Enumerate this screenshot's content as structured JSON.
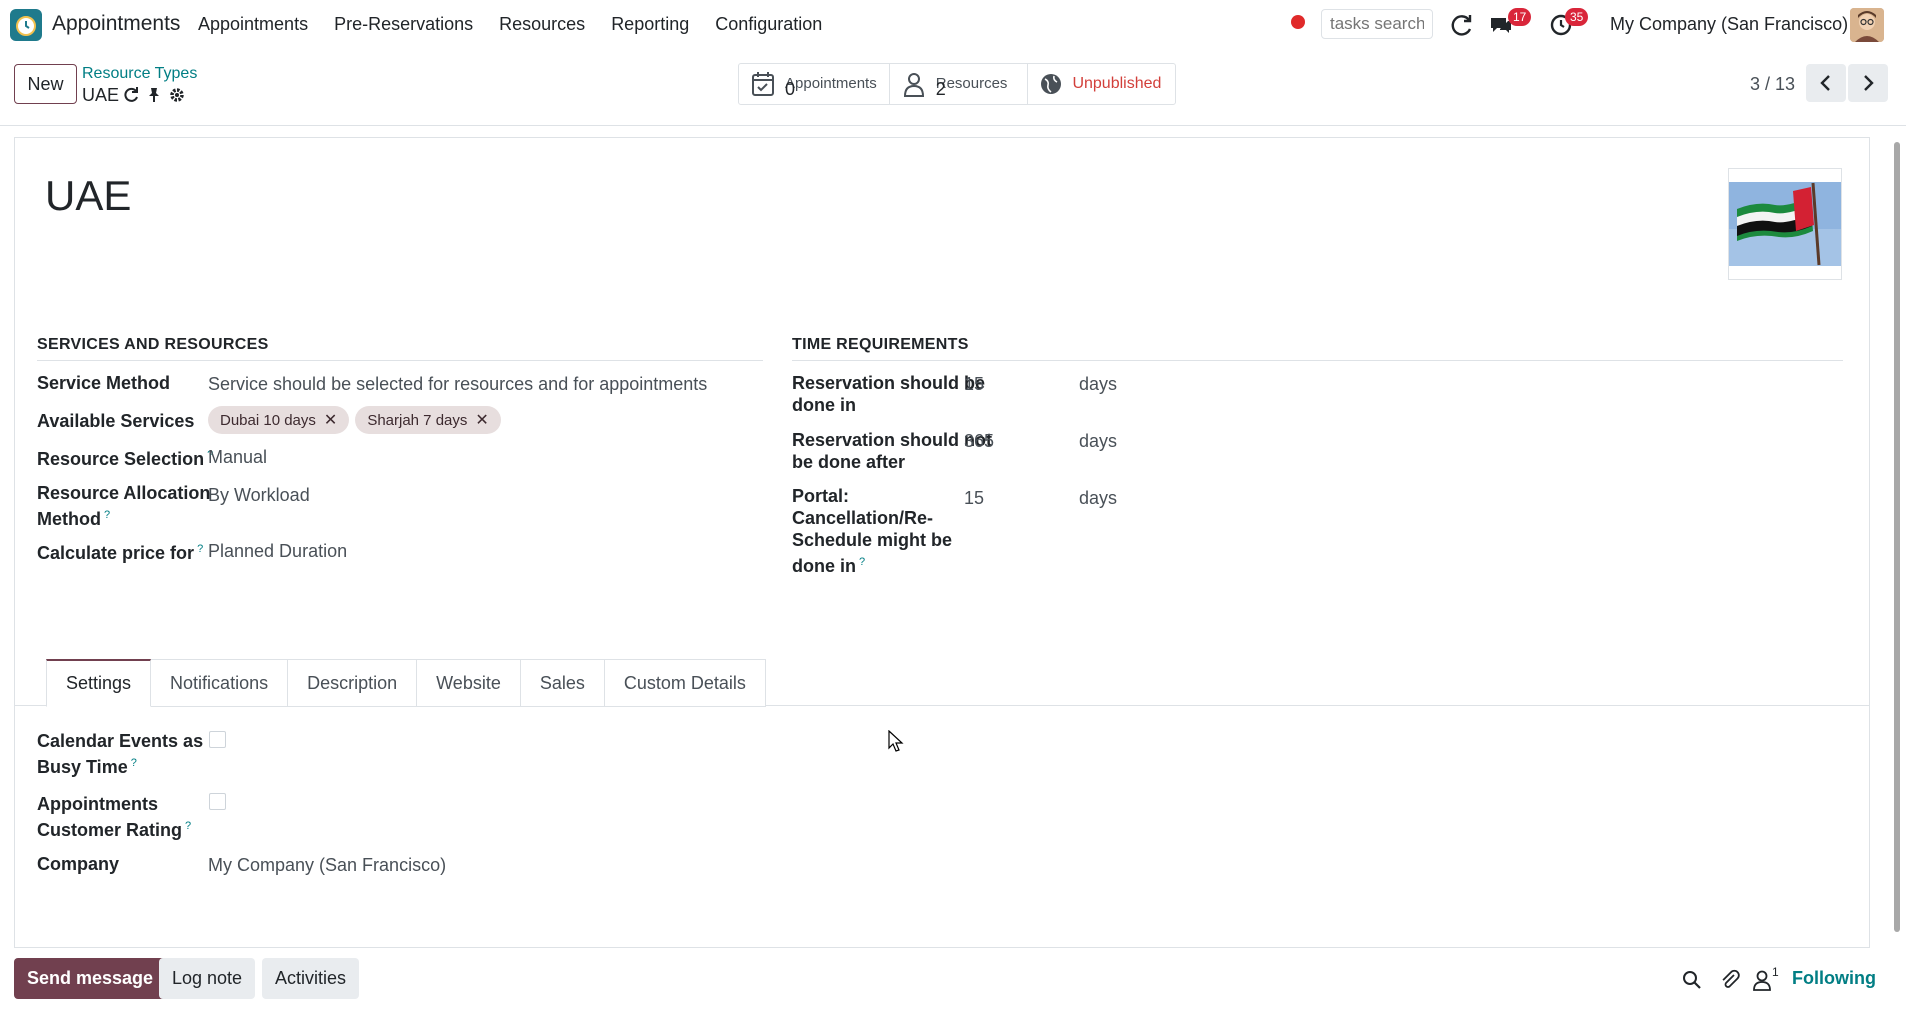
{
  "app": {
    "name": "Appointments"
  },
  "menu": [
    "Appointments",
    "Pre-Reservations",
    "Resources",
    "Reporting",
    "Configuration"
  ],
  "navbar": {
    "tasks_search_placeholder": "tasks search",
    "messages_count": "17",
    "activities_count": "35",
    "company": "My Company (San Francisco)"
  },
  "control_panel": {
    "new_label": "New",
    "breadcrumb_parent": "Resource Types",
    "breadcrumb_current": "UAE",
    "pager": "3 / 13"
  },
  "smart_buttons": {
    "appointments_label": "Appointments",
    "appointments_value": "0",
    "resources_label": "Resources",
    "resources_value": "2",
    "publish_label": "Unpublished"
  },
  "record": {
    "title": "UAE",
    "image_icon": "uae-flag-image"
  },
  "services_group": {
    "title": "SERVICES AND RESOURCES",
    "service_method_label": "Service Method",
    "service_method_value": "Service should be selected for resources and for appointments",
    "available_services_label": "Available Services",
    "available_services": [
      "Dubai 10 days",
      "Sharjah 7 days"
    ],
    "resource_selection_label": "Resource Selection",
    "resource_selection_value": "Manual",
    "allocation_label_line1": "Resource Allocation",
    "allocation_label_line2": "Method",
    "allocation_value": "By Workload",
    "price_label": "Calculate price for",
    "price_value": "Planned Duration",
    "help_mark": "?"
  },
  "time_group": {
    "title": "TIME REQUIREMENTS",
    "done_in_label_1": "Reservation should be",
    "done_in_label_2": "done in",
    "done_in_value": "15",
    "not_after_label_1": "Reservation should not",
    "not_after_label_2": "be done after",
    "not_after_value": "365",
    "portal_label_1": "Portal:",
    "portal_label_2": "Cancellation/Re-",
    "portal_label_3": "Schedule might be",
    "portal_label_4": "done in",
    "portal_value": "15",
    "unit": "days"
  },
  "tabs": [
    "Settings",
    "Notifications",
    "Description",
    "Website",
    "Sales",
    "Custom Details"
  ],
  "settings_tab": {
    "busy_label_1": "Calendar Events as",
    "busy_label_2": "Busy Time",
    "rating_label_1": "Appointments",
    "rating_label_2": "Customer Rating",
    "company_label": "Company",
    "company_value": "My Company (San Francisco)"
  },
  "chatter": {
    "send_message": "Send message",
    "log_note": "Log note",
    "activities": "Activities",
    "followers_count": "1",
    "following": "Following"
  },
  "colors": {
    "brand": "#71404f",
    "link": "#017e84",
    "badge": "#d9263a",
    "unpublished": "#d23f3a"
  }
}
